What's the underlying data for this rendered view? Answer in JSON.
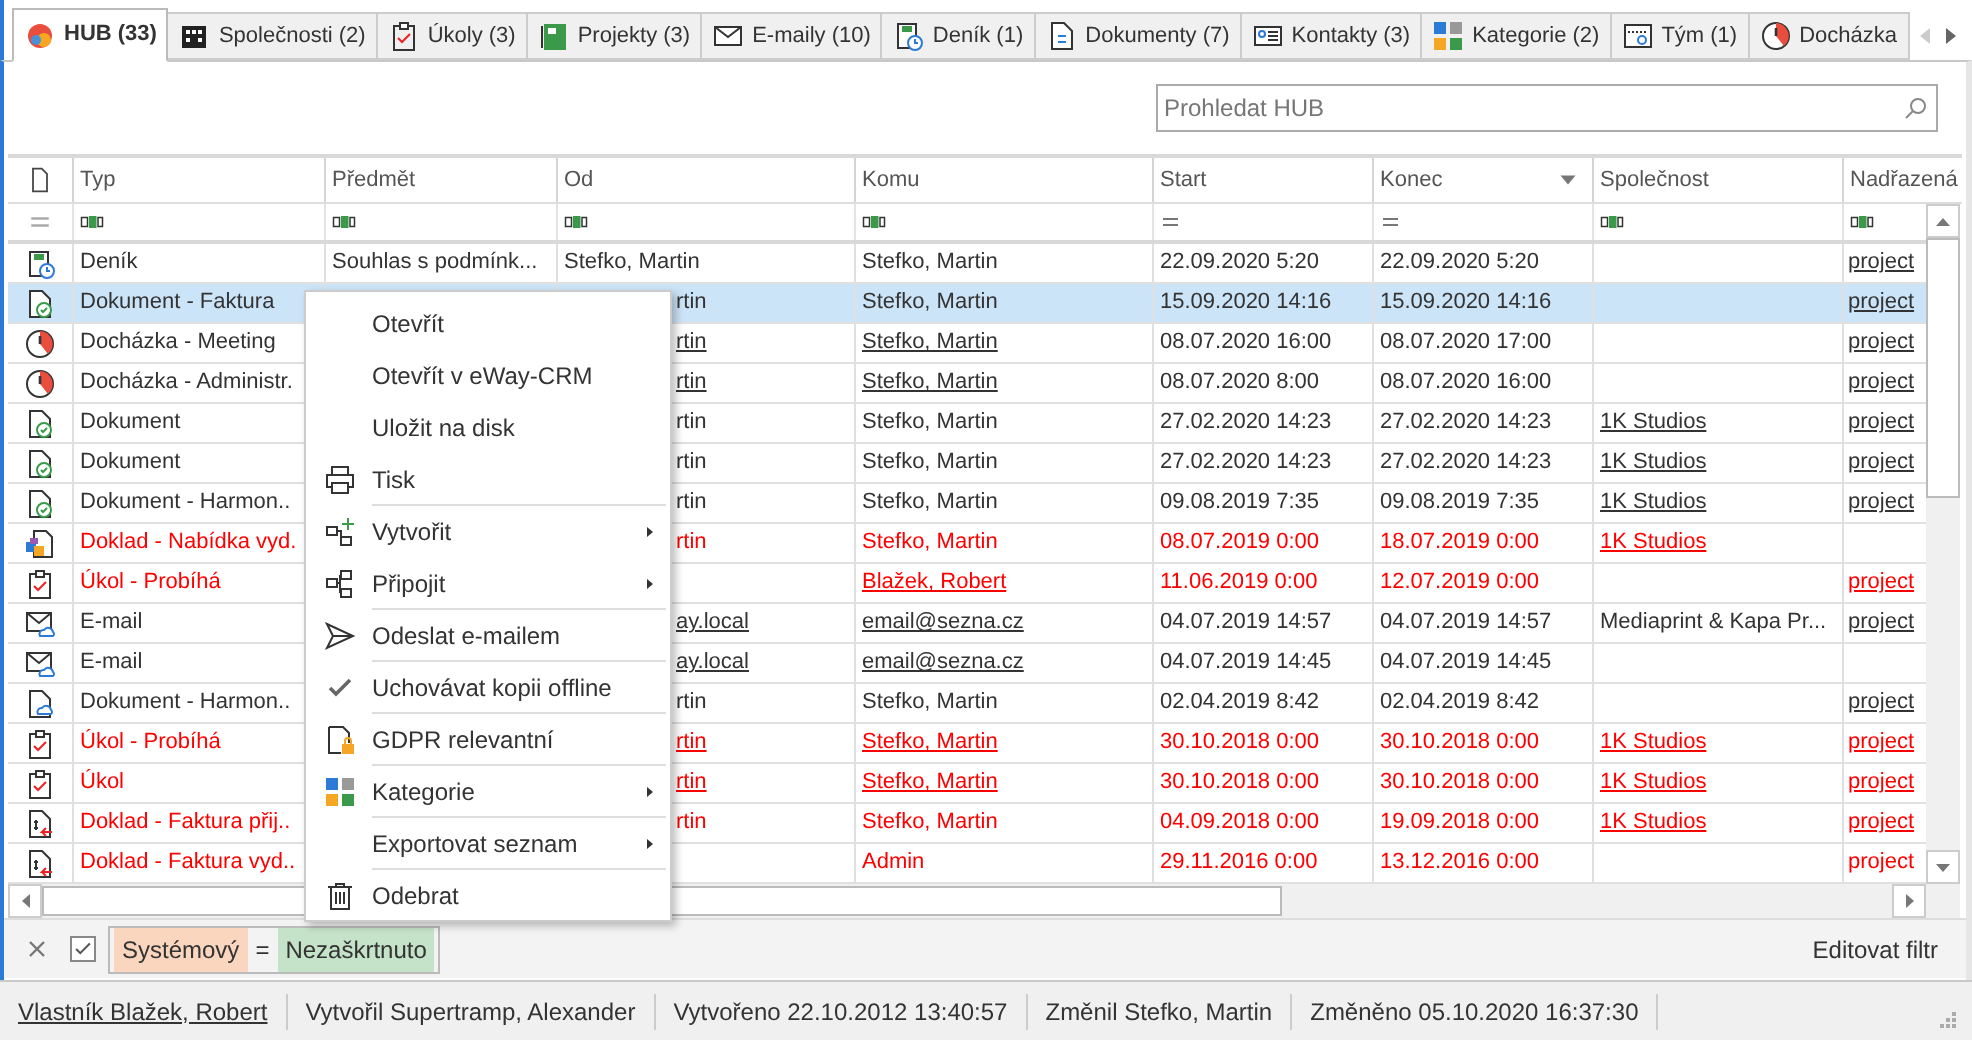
{
  "tabs": [
    {
      "label": "HUB (33)",
      "kind": "hub",
      "selected": true
    },
    {
      "label": "Společnosti (2)",
      "kind": "building",
      "selected": false
    },
    {
      "label": "Úkoly (3)",
      "kind": "task",
      "selected": false
    },
    {
      "label": "Projekty (3)",
      "kind": "project",
      "selected": false
    },
    {
      "label": "E-maily (10)",
      "kind": "email",
      "selected": false
    },
    {
      "label": "Deník (1)",
      "kind": "journal",
      "selected": false
    },
    {
      "label": "Dokumenty (7)",
      "kind": "document",
      "selected": false
    },
    {
      "label": "Kontakty (3)",
      "kind": "contact",
      "selected": false
    },
    {
      "label": "Kategorie (2)",
      "kind": "category",
      "selected": false
    },
    {
      "label": "Tým (1)",
      "kind": "team",
      "selected": false
    },
    {
      "label": "Docházka",
      "kind": "attendance",
      "selected": false
    }
  ],
  "search": {
    "placeholder": "Prohledat HUB"
  },
  "table": {
    "columns": [
      {
        "label": "Typ",
        "kind": "text",
        "sorted": false
      },
      {
        "label": "Předmět",
        "kind": "text",
        "sorted": false
      },
      {
        "label": "Od",
        "kind": "text",
        "sorted": false
      },
      {
        "label": "Komu",
        "kind": "text",
        "sorted": false
      },
      {
        "label": "Start",
        "kind": "date",
        "sorted": false
      },
      {
        "label": "Konec",
        "kind": "date",
        "sorted": true
      },
      {
        "label": "Společnost",
        "kind": "text",
        "sorted": false
      },
      {
        "label": "Nadřazená",
        "kind": "text",
        "sorted": false
      }
    ],
    "rows": [
      {
        "kind": "journal",
        "red": false,
        "selected": false,
        "cells": [
          {
            "text": "Deník",
            "link": false
          },
          {
            "text": "Souhlas s podmínk...",
            "link": false
          },
          {
            "text": "Stefko, Martin",
            "link": false
          },
          {
            "text": "Stefko, Martin",
            "link": false
          },
          {
            "text": "22.09.2020 5:20",
            "link": false
          },
          {
            "text": "22.09.2020 5:20",
            "link": false
          },
          null,
          {
            "text": "project",
            "link": true
          }
        ]
      },
      {
        "kind": "document",
        "red": false,
        "selected": true,
        "cells": [
          {
            "text": "Dokument - Faktura",
            "link": false
          },
          null,
          {
            "text": "rtin",
            "link": false,
            "partial": true
          },
          {
            "text": "Stefko, Martin",
            "link": false
          },
          {
            "text": "15.09.2020 14:16",
            "link": false
          },
          {
            "text": "15.09.2020 14:16",
            "link": false
          },
          null,
          {
            "text": "project",
            "link": true
          }
        ]
      },
      {
        "kind": "attendance",
        "red": false,
        "selected": false,
        "cells": [
          {
            "text": "Docházka - Meeting",
            "link": false
          },
          null,
          {
            "text": "rtin",
            "link": true,
            "partial": true
          },
          {
            "text": "Stefko, Martin",
            "link": true
          },
          {
            "text": "08.07.2020 16:00",
            "link": false
          },
          {
            "text": "08.07.2020 17:00",
            "link": false
          },
          null,
          {
            "text": "project",
            "link": true
          }
        ]
      },
      {
        "kind": "attendance",
        "red": false,
        "selected": false,
        "cells": [
          {
            "text": "Docházka - Administr.",
            "link": false
          },
          null,
          {
            "text": "rtin",
            "link": true,
            "partial": true
          },
          {
            "text": "Stefko, Martin",
            "link": true
          },
          {
            "text": "08.07.2020 8:00",
            "link": false
          },
          {
            "text": "08.07.2020 16:00",
            "link": false
          },
          null,
          {
            "text": "project",
            "link": true
          }
        ]
      },
      {
        "kind": "document",
        "red": false,
        "selected": false,
        "cells": [
          {
            "text": "Dokument",
            "link": false
          },
          null,
          {
            "text": "rtin",
            "link": false,
            "partial": true
          },
          {
            "text": "Stefko, Martin",
            "link": false
          },
          {
            "text": "27.02.2020 14:23",
            "link": false
          },
          {
            "text": "27.02.2020 14:23",
            "link": false
          },
          {
            "text": "1K Studios",
            "link": true
          },
          {
            "text": "project",
            "link": true
          }
        ]
      },
      {
        "kind": "document",
        "red": false,
        "selected": false,
        "cells": [
          {
            "text": "Dokument",
            "link": false
          },
          null,
          {
            "text": "rtin",
            "link": false,
            "partial": true
          },
          {
            "text": "Stefko, Martin",
            "link": false
          },
          {
            "text": "27.02.2020 14:23",
            "link": false
          },
          {
            "text": "27.02.2020 14:23",
            "link": false
          },
          {
            "text": "1K Studios",
            "link": true
          },
          {
            "text": "project",
            "link": true
          }
        ]
      },
      {
        "kind": "document",
        "red": false,
        "selected": false,
        "cells": [
          {
            "text": "Dokument - Harmon..",
            "link": false
          },
          null,
          {
            "text": "rtin",
            "link": false,
            "partial": true
          },
          {
            "text": "Stefko, Martin",
            "link": false
          },
          {
            "text": "09.08.2019 7:35",
            "link": false
          },
          {
            "text": "09.08.2019 7:35",
            "link": false
          },
          {
            "text": "1K Studios",
            "link": true
          },
          {
            "text": "project",
            "link": true
          }
        ]
      },
      {
        "kind": "offer",
        "red": true,
        "selected": false,
        "cells": [
          {
            "text": "Doklad - Nabídka vyd.",
            "link": false
          },
          null,
          {
            "text": "rtin",
            "link": false,
            "partial": true
          },
          {
            "text": "Stefko, Martin",
            "link": false
          },
          {
            "text": "08.07.2019 0:00",
            "link": false
          },
          {
            "text": "18.07.2019 0:00",
            "link": false
          },
          {
            "text": "1K Studios",
            "link": true
          },
          null
        ]
      },
      {
        "kind": "task",
        "red": true,
        "selected": false,
        "cells": [
          {
            "text": "Úkol - Probíhá",
            "link": false
          },
          null,
          null,
          {
            "text": "Blažek, Robert",
            "link": true
          },
          {
            "text": "11.06.2019 0:00",
            "link": false
          },
          {
            "text": "12.07.2019 0:00",
            "link": false
          },
          null,
          {
            "text": "project",
            "link": true
          }
        ]
      },
      {
        "kind": "email",
        "red": false,
        "selected": false,
        "cells": [
          {
            "text": "E-mail",
            "link": false
          },
          null,
          {
            "text": "ay.local",
            "link": true,
            "partial": true
          },
          {
            "text": "email@sezna.cz",
            "link": true
          },
          {
            "text": "04.07.2019 14:57",
            "link": false
          },
          {
            "text": "04.07.2019 14:57",
            "link": false
          },
          {
            "text": "Mediaprint & Kapa Pr...",
            "link": false
          },
          {
            "text": "project",
            "link": true
          }
        ]
      },
      {
        "kind": "email",
        "red": false,
        "selected": false,
        "cells": [
          {
            "text": "E-mail",
            "link": false
          },
          null,
          {
            "text": "ay.local",
            "link": true,
            "partial": true
          },
          {
            "text": "email@sezna.cz",
            "link": true
          },
          {
            "text": "04.07.2019 14:45",
            "link": false
          },
          {
            "text": "04.07.2019 14:45",
            "link": false
          },
          null,
          null
        ]
      },
      {
        "kind": "document-cloud",
        "red": false,
        "selected": false,
        "cells": [
          {
            "text": "Dokument - Harmon..",
            "link": false
          },
          null,
          {
            "text": "rtin",
            "link": false,
            "partial": true
          },
          {
            "text": "Stefko, Martin",
            "link": false
          },
          {
            "text": "02.04.2019 8:42",
            "link": false
          },
          {
            "text": "02.04.2019 8:42",
            "link": false
          },
          null,
          {
            "text": "project",
            "link": true
          }
        ]
      },
      {
        "kind": "task",
        "red": true,
        "selected": false,
        "cells": [
          {
            "text": "Úkol - Probíhá",
            "link": false
          },
          null,
          {
            "text": "rtin",
            "link": true,
            "partial": true
          },
          {
            "text": "Stefko, Martin",
            "link": true
          },
          {
            "text": "30.10.2018 0:00",
            "link": false
          },
          {
            "text": "30.10.2018 0:00",
            "link": false
          },
          {
            "text": "1K Studios",
            "link": true
          },
          {
            "text": "project",
            "link": true
          }
        ]
      },
      {
        "kind": "task",
        "red": true,
        "selected": false,
        "cells": [
          {
            "text": "Úkol",
            "link": false
          },
          null,
          {
            "text": "rtin",
            "link": true,
            "partial": true
          },
          {
            "text": "Stefko, Martin",
            "link": true
          },
          {
            "text": "30.10.2018 0:00",
            "link": false
          },
          {
            "text": "30.10.2018 0:00",
            "link": false
          },
          {
            "text": "1K Studios",
            "link": true
          },
          {
            "text": "project",
            "link": true
          }
        ]
      },
      {
        "kind": "invoice",
        "red": true,
        "selected": false,
        "cells": [
          {
            "text": "Doklad - Faktura přij..",
            "link": false
          },
          null,
          {
            "text": "rtin",
            "link": false,
            "partial": true
          },
          {
            "text": "Stefko, Martin",
            "link": false
          },
          {
            "text": "04.09.2018 0:00",
            "link": false
          },
          {
            "text": "19.09.2018 0:00",
            "link": false
          },
          {
            "text": "1K Studios",
            "link": true
          },
          {
            "text": "project",
            "link": true
          }
        ]
      },
      {
        "kind": "invoice",
        "red": true,
        "selected": false,
        "cells": [
          {
            "text": "Doklad - Faktura vyd..",
            "link": false
          },
          null,
          null,
          {
            "text": "Admin",
            "link": false
          },
          {
            "text": "29.11.2016 0:00",
            "link": false
          },
          {
            "text": "13.12.2016 0:00",
            "link": false
          },
          null,
          {
            "text": "project",
            "link": false
          }
        ]
      }
    ]
  },
  "context_menu": [
    {
      "label": "Otevřít",
      "kind": "plain",
      "submenu": false,
      "separator_before": false
    },
    {
      "label": "Otevřít v eWay-CRM",
      "kind": "plain",
      "submenu": false,
      "separator_before": false
    },
    {
      "label": "Uložit na disk",
      "kind": "plain",
      "submenu": false,
      "separator_before": false
    },
    {
      "label": "Tisk",
      "kind": "print",
      "submenu": false,
      "separator_before": false
    },
    {
      "label": "Vytvořit",
      "kind": "create",
      "submenu": true,
      "separator_before": true
    },
    {
      "label": "Připojit",
      "kind": "attach",
      "submenu": true,
      "separator_before": false
    },
    {
      "label": "Odeslat e-mailem",
      "kind": "send",
      "submenu": false,
      "separator_before": true
    },
    {
      "label": "Uchovávat kopii offline",
      "kind": "check",
      "submenu": false,
      "separator_before": true
    },
    {
      "label": "GDPR relevantní",
      "kind": "gdpr",
      "submenu": false,
      "separator_before": true
    },
    {
      "label": "Kategorie",
      "kind": "category",
      "submenu": true,
      "separator_before": true
    },
    {
      "label": "Exportovat seznam",
      "kind": "plain",
      "submenu": true,
      "separator_before": true
    },
    {
      "label": "Odebrat",
      "kind": "trash",
      "submenu": false,
      "separator_before": true
    }
  ],
  "filter_bar": {
    "checked": true,
    "field": "Systémový",
    "operator": "=",
    "value": "Nezaškrtnuto",
    "edit_link": "Editovat filtr"
  },
  "status_bar": [
    {
      "text": "Vlastník Blažek, Robert",
      "link": true
    },
    {
      "text": "Vytvořil Supertramp, Alexander",
      "link": false
    },
    {
      "text": "Vytvořeno 22.10.2012 13:40:57",
      "link": false
    },
    {
      "text": "Změnil Stefko, Martin",
      "link": false
    },
    {
      "text": "Změněno 05.10.2020 16:37:30",
      "link": false
    }
  ]
}
